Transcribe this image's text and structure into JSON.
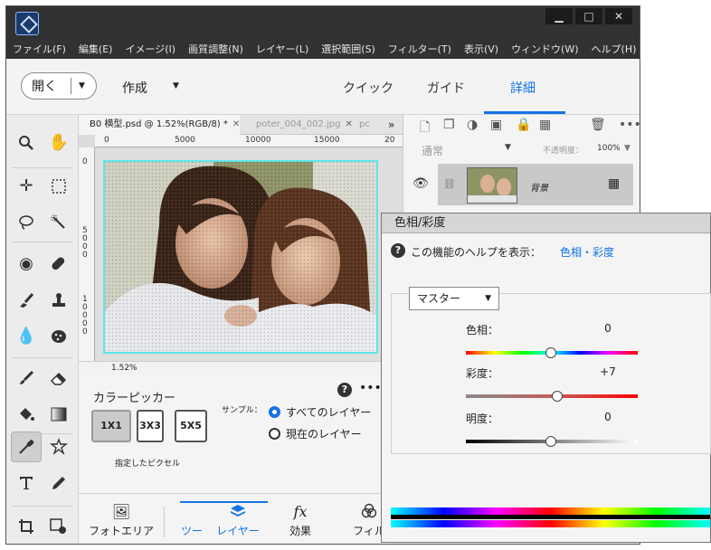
{
  "window": {
    "minimize": "▁",
    "maximize": "□",
    "close": "✕"
  },
  "menu": [
    "ファイル(F)",
    "編集(E)",
    "イメージ(I)",
    "画質調整(N)",
    "レイヤー(L)",
    "選択範囲(S)",
    "フィルター(T)",
    "表示(V)",
    "ウィンドウ(W)",
    "ヘルプ(H)"
  ],
  "topbar": {
    "open_label": "開く",
    "create_label": "作成",
    "modes": [
      "クイック",
      "ガイド",
      "詳細"
    ],
    "active_mode": "詳細"
  },
  "tools_icons": [
    "zoom-icon",
    "hand-icon",
    "move-icon",
    "marquee-icon",
    "lasso-icon",
    "quick-selection-icon",
    "red-eye-icon",
    "spot-healing-icon",
    "smart-brush-icon",
    "clone-stamp-icon",
    "blur-icon",
    "sponge-icon",
    "brush-icon",
    "eraser-icon",
    "paint-bucket-icon",
    "gradient-icon",
    "eyedropper-icon",
    "custom-shape-icon",
    "type-icon",
    "pencil-icon",
    "crop-icon",
    "recompose-icon"
  ],
  "document": {
    "tabs": [
      {
        "label": "B0 横型.psd @ 1.52%(RGB/8) *",
        "close": "✕"
      },
      {
        "label": "poter_004_002.jpg",
        "close": "✕"
      },
      {
        "label": "pc"
      }
    ],
    "overflow": "»",
    "ruler_h": [
      "0",
      "5000",
      "10000",
      "15000",
      "20"
    ],
    "ruler_v": [
      "0",
      "5\n0\n0\n0",
      "1\n0\n0\n0\n0"
    ],
    "zoom": "1.52%"
  },
  "tool_options": {
    "title": "カラーピッカー",
    "sizes": [
      "1X1",
      "3X3",
      "5X5"
    ],
    "selected_size": "1X1",
    "size_caption": "指定したピクセル",
    "sample_label": "サンプル：",
    "radio_all": "すべてのレイヤー",
    "radio_current": "現在のレイヤー",
    "help": "?",
    "more": "•••"
  },
  "bottom_tabs": [
    {
      "label": "フォトエリア"
    },
    {
      "label": "ツー"
    },
    {
      "label": "レイヤー"
    },
    {
      "label": "効果"
    },
    {
      "label": "フィル"
    }
  ],
  "layers_panel": {
    "blend_mode": "通常",
    "opacity_label": "不透明度：",
    "opacity_value": "100%",
    "layer_name": "背景",
    "more": "•••"
  },
  "hue_saturation": {
    "title": "色相/彩度",
    "help_icon": "?",
    "help_text": "この機能のヘルプを表示：",
    "help_link": "色相・彩度",
    "channel": "マスター",
    "hue_label": "色相：",
    "hue_value": "0",
    "saturation_label": "彩度：",
    "saturation_value": "+7",
    "lightness_label": "明度：",
    "lightness_value": "0"
  },
  "colors": {
    "accent": "#1473e6",
    "selection": "#5fe6ea"
  }
}
